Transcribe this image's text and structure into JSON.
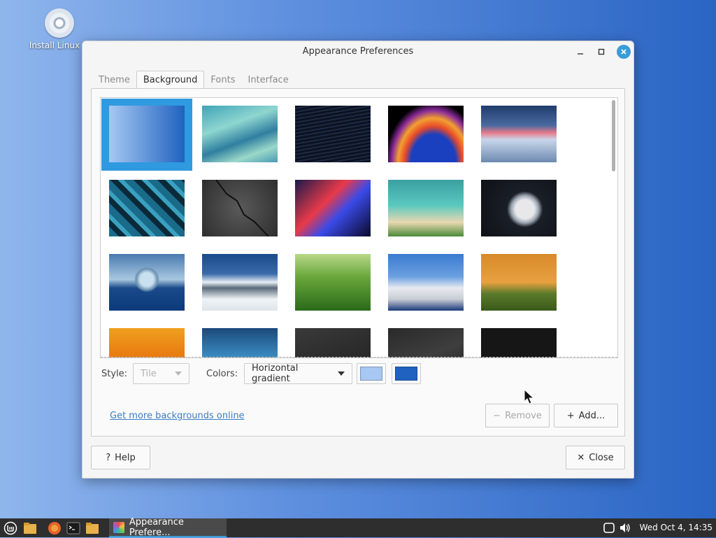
{
  "desktop": {
    "icon_label": "Install Linux M"
  },
  "window": {
    "title": "Appearance Preferences",
    "tabs": [
      {
        "label": "Theme",
        "active": false
      },
      {
        "label": "Background",
        "active": true
      },
      {
        "label": "Fonts",
        "active": false
      },
      {
        "label": "Interface",
        "active": false
      }
    ],
    "style_label": "Style:",
    "style_value": "Tile",
    "colors_label": "Colors:",
    "colors_value": "Horizontal gradient",
    "color1": "#a6c8f2",
    "color2": "#1f62bf",
    "link": "Get more backgrounds online",
    "remove_label": "Remove",
    "add_label": "Add...",
    "help_label": "Help",
    "close_label": "Close"
  },
  "taskbar": {
    "task_label": "Appearance Prefere...",
    "clock": "Wed Oct  4, 14:35"
  }
}
